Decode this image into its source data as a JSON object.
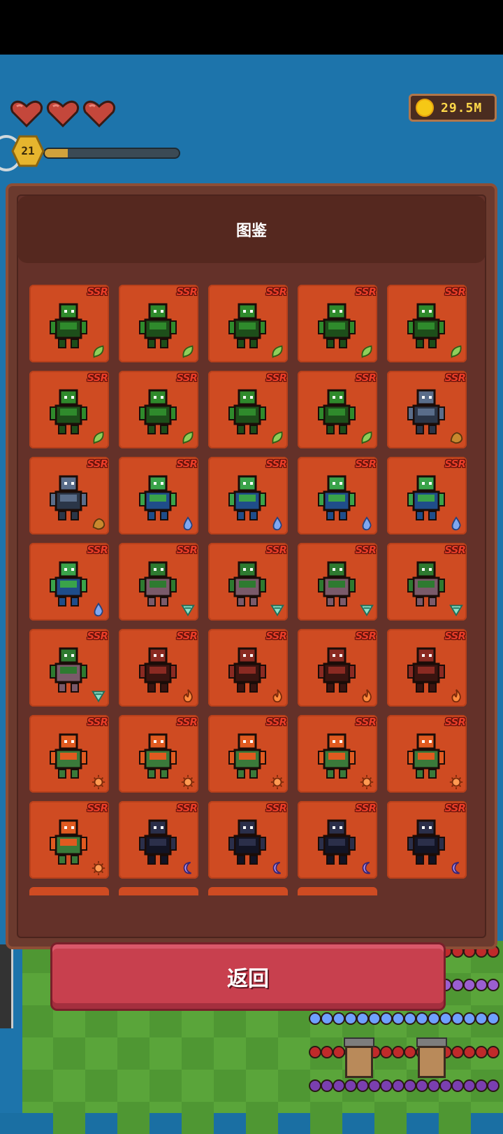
{
  "hud": {
    "lives": 3,
    "level": "21",
    "xp_progress": 0.17,
    "coins": "29.5M"
  },
  "collection": {
    "title": "图鉴",
    "rarity_label": "SSR",
    "cards": [
      {
        "creature": "orc-axe",
        "element": "leaf-icon"
      },
      {
        "creature": "orc-spear",
        "element": "leaf-icon"
      },
      {
        "creature": "orc-wolf-rider-sword",
        "element": "leaf-icon"
      },
      {
        "creature": "goblin-wolf-rider",
        "element": "leaf-icon"
      },
      {
        "creature": "skeleton-orc-shaman",
        "element": "leaf-icon"
      },
      {
        "creature": "wolf-warrior",
        "element": "leaf-icon"
      },
      {
        "creature": "goblin",
        "element": "leaf-icon"
      },
      {
        "creature": "treant-small",
        "element": "leaf-icon"
      },
      {
        "creature": "treant-large",
        "element": "leaf-icon"
      },
      {
        "creature": "stone-golem-gold",
        "element": "earth-icon"
      },
      {
        "creature": "stone-golem",
        "element": "earth-icon"
      },
      {
        "creature": "green-slime",
        "element": "water-icon"
      },
      {
        "creature": "green-ogre",
        "element": "water-icon"
      },
      {
        "creature": "naga",
        "element": "water-icon"
      },
      {
        "creature": "elf-sage",
        "element": "water-icon"
      },
      {
        "creature": "water-elemental",
        "element": "water-icon"
      },
      {
        "creature": "goblin-crouch",
        "element": "wind-icon"
      },
      {
        "creature": "goblin-dagger",
        "element": "wind-icon"
      },
      {
        "creature": "imp",
        "element": "wind-icon"
      },
      {
        "creature": "bat",
        "element": "wind-icon"
      },
      {
        "creature": "cyclops-mage",
        "element": "wind-icon"
      },
      {
        "creature": "minotaur-red",
        "element": "fire-icon"
      },
      {
        "creature": "demon-winged",
        "element": "fire-icon"
      },
      {
        "creature": "horned-demon",
        "element": "fire-icon"
      },
      {
        "creature": "demon-lord",
        "element": "fire-icon"
      },
      {
        "creature": "fire-elemental",
        "element": "sun-icon"
      },
      {
        "creature": "centaur",
        "element": "sun-icon"
      },
      {
        "creature": "dryad",
        "element": "sun-icon"
      },
      {
        "creature": "green-spirit",
        "element": "sun-icon"
      },
      {
        "creature": "fairy",
        "element": "sun-icon"
      },
      {
        "creature": "wisp",
        "element": "sun-icon"
      },
      {
        "creature": "reaper",
        "element": "moon-icon"
      },
      {
        "creature": "dark-knight",
        "element": "moon-icon"
      },
      {
        "creature": "shade",
        "element": "moon-icon"
      },
      {
        "creature": "armored-wraith",
        "element": "moon-icon"
      }
    ]
  },
  "actions": {
    "return_label": "返回"
  },
  "colors": {
    "card_bg": "#cf4b22",
    "panel": "#6b3a2e",
    "button": "#c8404e",
    "sea": "#1d74ab",
    "coin": "#f5c816"
  }
}
